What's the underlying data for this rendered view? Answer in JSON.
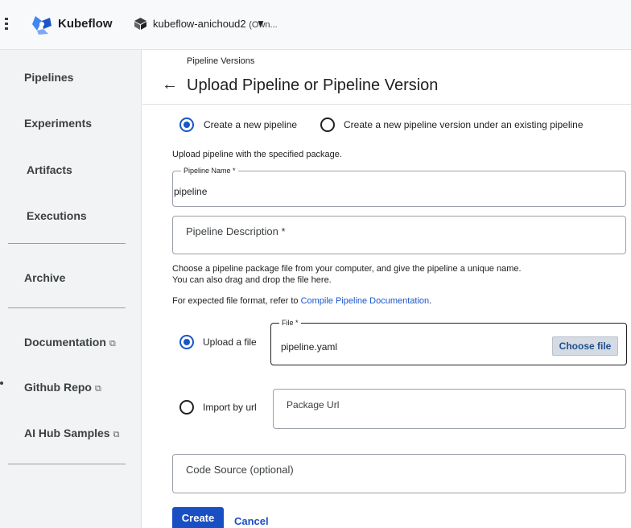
{
  "header": {
    "brand": "Kubeflow",
    "namespace": "kubeflow-anichoud2",
    "namespace_suffix": "(Own...",
    "caret": "▼"
  },
  "sidebar": {
    "items": [
      {
        "label": "Pipelines",
        "external": false
      },
      {
        "label": "Experiments",
        "external": false
      },
      {
        "label": "Artifacts",
        "external": false
      },
      {
        "label": "Executions",
        "external": false
      },
      {
        "label": "Archive",
        "external": false
      },
      {
        "label": "Documentation",
        "external": true
      },
      {
        "label": "Github Repo",
        "external": true
      },
      {
        "label": "AI Hub Samples",
        "external": true
      }
    ],
    "external_glyph": "⧉"
  },
  "main": {
    "breadcrumb": "Pipeline Versions",
    "back_arrow": "←",
    "title": "Upload Pipeline or Pipeline Version",
    "mode_options": [
      {
        "label": "Create a new pipeline",
        "checked": true
      },
      {
        "label": "Create a new pipeline version under an existing pipeline",
        "checked": false
      }
    ],
    "upload_hint": "Upload pipeline with the specified package.",
    "pipeline_name": {
      "label": "Pipeline Name *",
      "value": "pipeline"
    },
    "pipeline_description": {
      "placeholder": "Pipeline Description *"
    },
    "instructions_line1": "Choose a pipeline package file from your computer, and give the pipeline a unique name.",
    "instructions_line2": "You can also drag and drop the file here.",
    "format_prefix": "For expected file format, refer to ",
    "format_link": "Compile Pipeline Documentation",
    "format_suffix": ".",
    "upload_option": {
      "label": "Upload a file",
      "checked": true
    },
    "file_field": {
      "label": "File *",
      "value": "pipeline.yaml",
      "button": "Choose file"
    },
    "url_option": {
      "label": "Import by url",
      "checked": false
    },
    "package_url": {
      "placeholder": "Package Url"
    },
    "code_source": {
      "placeholder": "Code Source (optional)"
    },
    "create_button": "Create",
    "cancel_button": "Cancel"
  },
  "colors": {
    "accent": "#1a56c9",
    "primary_button": "#1a4fc4",
    "sidebar_bg": "#f1f3f4"
  }
}
